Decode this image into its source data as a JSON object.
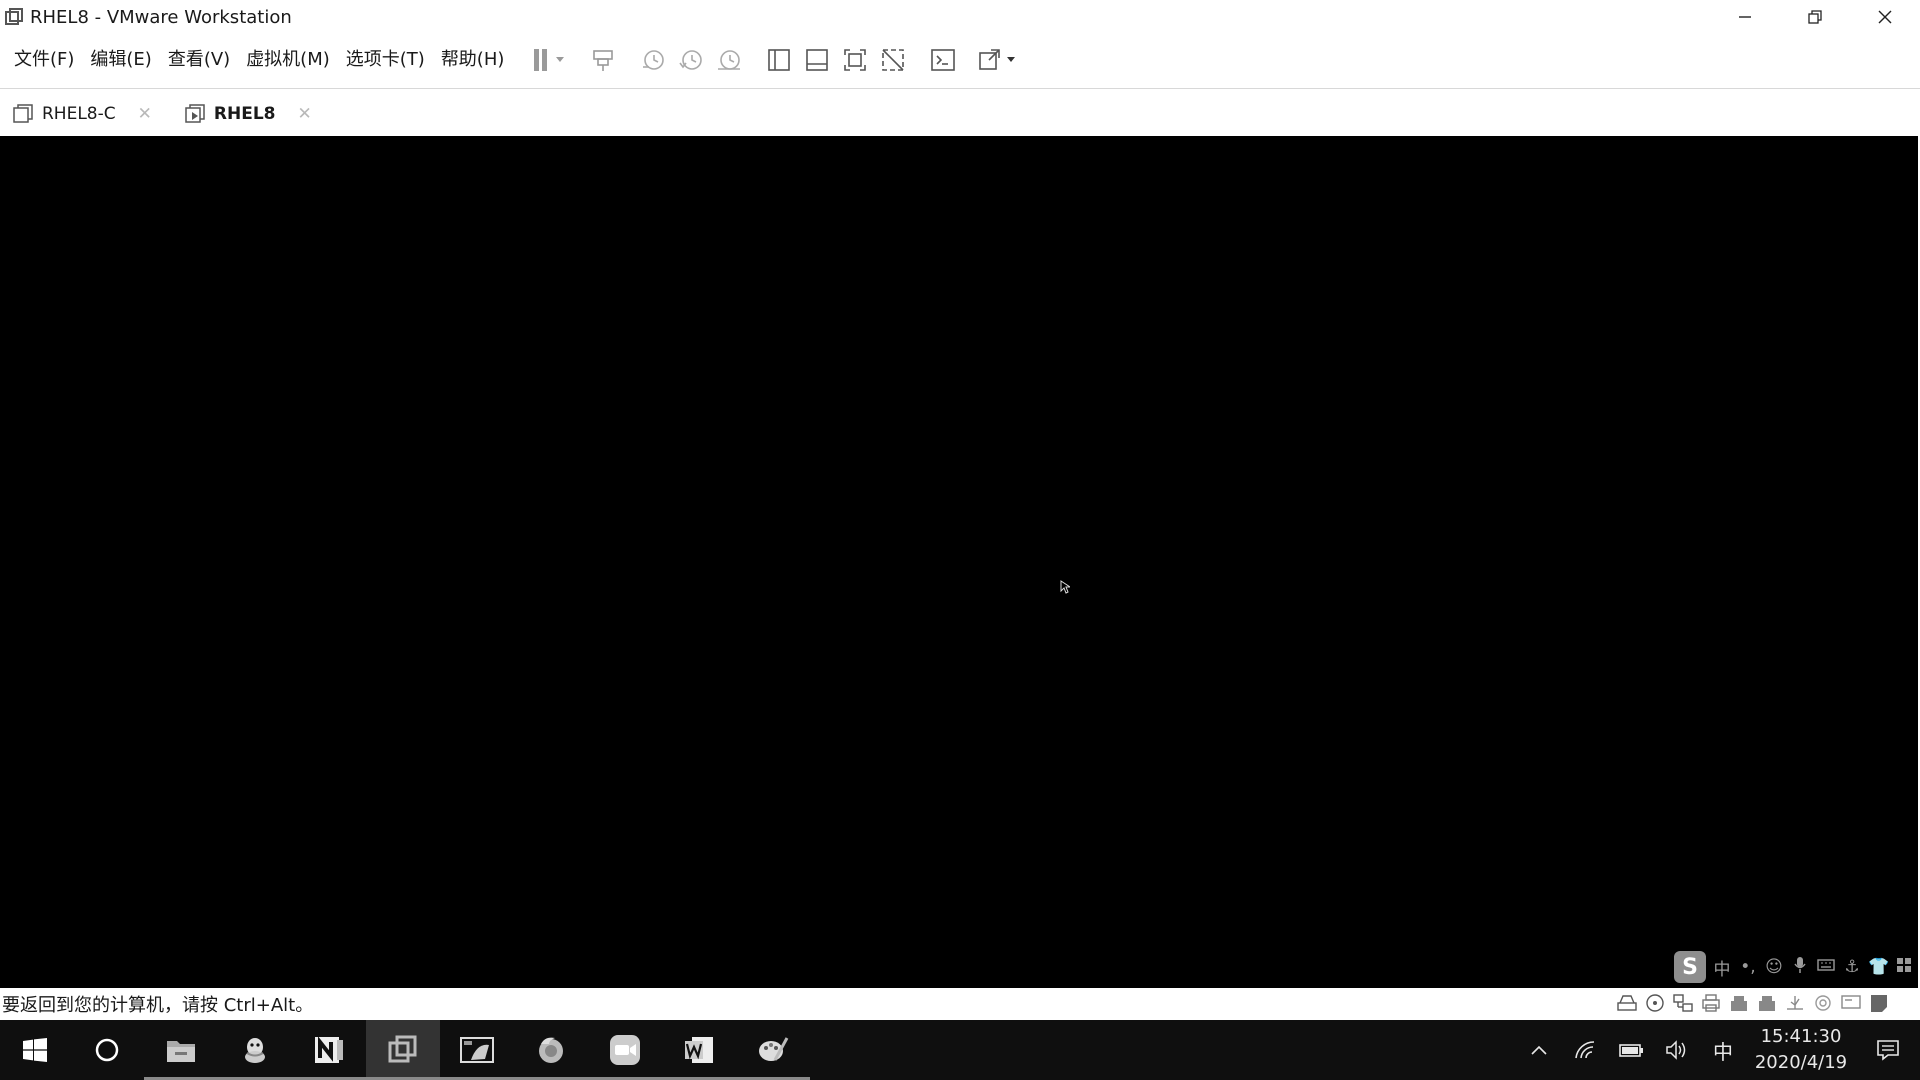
{
  "window": {
    "title": "RHEL8 - VMware Workstation",
    "icon": "vmware-app-icon",
    "controls": [
      "minimize-icon",
      "restore-icon",
      "close-icon"
    ]
  },
  "menu": [
    {
      "label": "文件(F)"
    },
    {
      "label": "编辑(E)"
    },
    {
      "label": "查看(V)"
    },
    {
      "label": "虚拟机(M)"
    },
    {
      "label": "选项卡(T)"
    },
    {
      "label": "帮助(H)"
    }
  ],
  "toolbar": [
    "pause-icon",
    "send-ctrl-alt-del-icon",
    "snapshot-icon",
    "revert-snapshot-icon",
    "snapshot-manager-icon",
    "library-view-icon",
    "thumbnail-view-icon",
    "fullscreen-icon",
    "unity-icon",
    "console-icon",
    "stretch-guest-icon"
  ],
  "tabs": [
    {
      "label": "RHEL8-C",
      "active": false
    },
    {
      "label": "RHEL8",
      "active": true
    }
  ],
  "status": {
    "text": "要返回到您的计算机，请按 Ctrl+Alt。"
  },
  "ime": {
    "logo": "S",
    "mode": "中",
    "punct": "•,"
  },
  "taskbar": {
    "apps": [
      "file-explorer-icon",
      "qq-icon",
      "onenote-icon",
      "vmware-icon",
      "screenshot-icon",
      "firefox-icon",
      "zoom-icon",
      "word-icon",
      "paint-icon"
    ],
    "ime_indicator": "中",
    "time": "15:41:30",
    "date": "2020/4/19"
  },
  "colors": {
    "vm_background": "#000000",
    "taskbar": "#0f0f0f",
    "accent": "#ffffff"
  }
}
